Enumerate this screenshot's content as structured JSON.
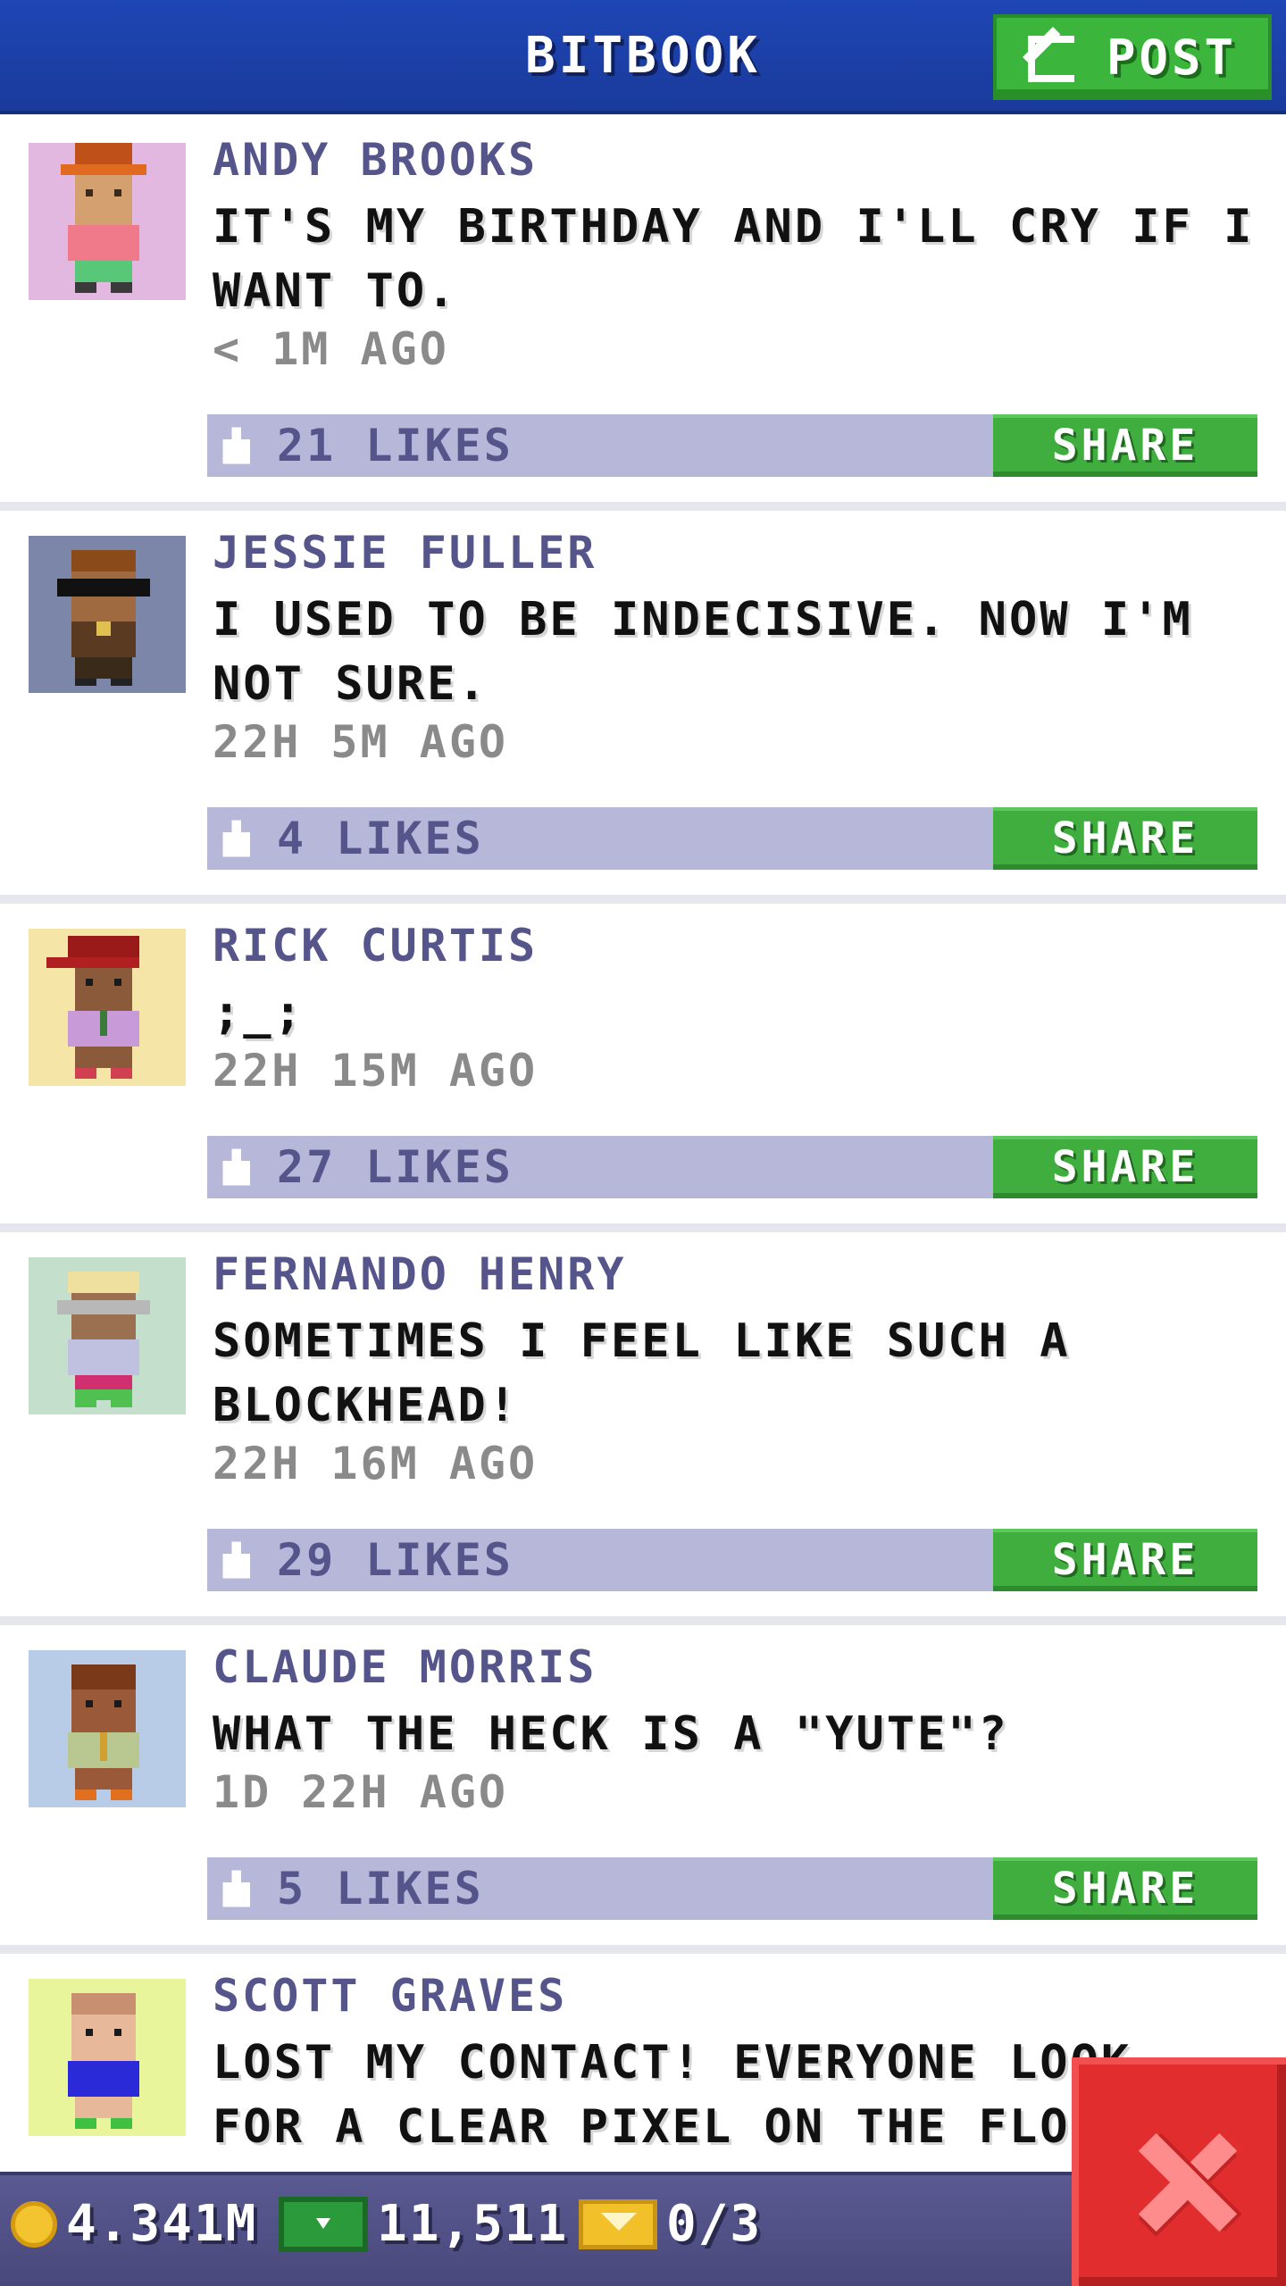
{
  "header": {
    "title": "BITBOOK",
    "post_label": "POST"
  },
  "posts": [
    {
      "author": "ANDY BROOKS",
      "message": "IT'S MY BIRTHDAY AND I'LL CRY IF I WANT TO.",
      "time": "< 1M AGO",
      "likes": "21 LIKES",
      "share_label": "SHARE"
    },
    {
      "author": "JESSIE FULLER",
      "message": "I USED TO BE INDECISIVE. NOW I'M NOT SURE.",
      "time": "22H 5M AGO",
      "likes": "4 LIKES",
      "share_label": "SHARE"
    },
    {
      "author": "RICK CURTIS",
      "message": ";_;",
      "time": "22H 15M AGO",
      "likes": "27 LIKES",
      "share_label": "SHARE"
    },
    {
      "author": "FERNANDO HENRY",
      "message": "SOMETIMES I FEEL LIKE SUCH A BLOCKHEAD!",
      "time": "22H 16M AGO",
      "likes": "29 LIKES",
      "share_label": "SHARE"
    },
    {
      "author": "CLAUDE MORRIS",
      "message": "WHAT THE HECK IS A \"YUTE\"?",
      "time": "1D 22H AGO",
      "likes": "5 LIKES",
      "share_label": "SHARE"
    },
    {
      "author": "SCOTT GRAVES",
      "message": "LOST MY CONTACT! EVERYONE LOOK FOR A CLEAR PIXEL ON THE FLOO",
      "time": "",
      "likes": "",
      "share_label": ""
    }
  ],
  "bottom_bar": {
    "coins": "4.341M",
    "bux": "11,511",
    "tickets": "0/3"
  },
  "icons": [
    "edit-icon",
    "thumbs-up-icon",
    "coin-icon",
    "cash-icon",
    "ticket-icon",
    "close-icon"
  ],
  "colors": {
    "header": "#1e46b4",
    "accent_green": "#3fae3f",
    "likes_bar": "#b7b7d9",
    "close_red": "#e12d2d",
    "name_purple": "#55558c"
  }
}
